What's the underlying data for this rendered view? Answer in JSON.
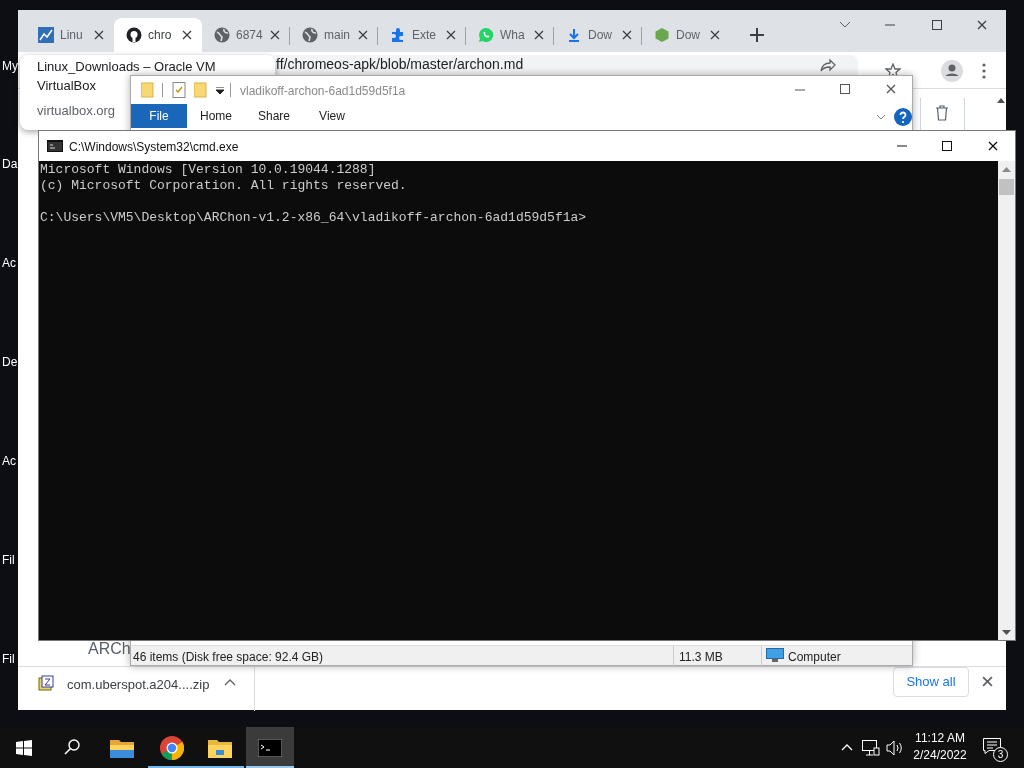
{
  "desktop_icons": [
    {
      "label": "My"
    },
    {
      "label": "Da"
    },
    {
      "label": "Ac"
    },
    {
      "label": "De"
    },
    {
      "label": "Ac"
    },
    {
      "label": "Fil"
    },
    {
      "label": "Fil"
    }
  ],
  "browser": {
    "tabs": [
      {
        "title": "Linu",
        "kind": "chart",
        "selected": false
      },
      {
        "title": "chro",
        "kind": "github",
        "selected": true
      },
      {
        "title": "6874",
        "kind": "globe",
        "selected": false
      },
      {
        "title": "main",
        "kind": "globe",
        "selected": false
      },
      {
        "title": "Exte",
        "kind": "puzzle",
        "selected": false
      },
      {
        "title": "Wha",
        "kind": "chat",
        "selected": false
      },
      {
        "title": "Dow",
        "kind": "download",
        "selected": false
      },
      {
        "title": "Dow",
        "kind": "cube",
        "selected": false
      }
    ],
    "address": "ff/chromeos-apk/blob/master/archon.md",
    "hover_card": {
      "title_lines": [
        "Linux_Downloads – Oracle VM",
        "VirtualBox"
      ],
      "domain": "virtualbox.org"
    },
    "page_text": "ARCh",
    "download_shelf": {
      "file": "com.uberspot.a204....zip",
      "show_all": "Show all"
    }
  },
  "explorer": {
    "title": "vladikoff-archon-6ad1d59d5f1a",
    "ribbon_tabs": [
      {
        "label": "File",
        "selected": true
      },
      {
        "label": "Home",
        "selected": false
      },
      {
        "label": "Share",
        "selected": false
      },
      {
        "label": "View",
        "selected": false
      }
    ],
    "status_bar": {
      "items": "46 items (Disk free space: 92.4 GB)",
      "size": "11.3 MB",
      "zone": "Computer"
    }
  },
  "console": {
    "title": "C:\\Windows\\System32\\cmd.exe",
    "blocks": [
      [
        "Microsoft Windows [Version 10.0.19044.1288]",
        "(c) Microsoft Corporation. All rights reserved."
      ],
      [
        "C:\\Users\\VM5\\Desktop\\ARChon-v1.2-x86_64\\vladikoff-archon-6ad1d59d5f1a>"
      ]
    ]
  },
  "taskbar": {
    "apps": [
      {
        "kind": "folder",
        "running": false,
        "selected": false
      },
      {
        "kind": "chrome",
        "running": true,
        "selected": false
      },
      {
        "kind": "explorer",
        "running": true,
        "selected": false
      },
      {
        "kind": "console",
        "running": true,
        "selected": true
      }
    ],
    "time": "11:12 AM",
    "date": "2/24/2022",
    "notifications": "3"
  }
}
